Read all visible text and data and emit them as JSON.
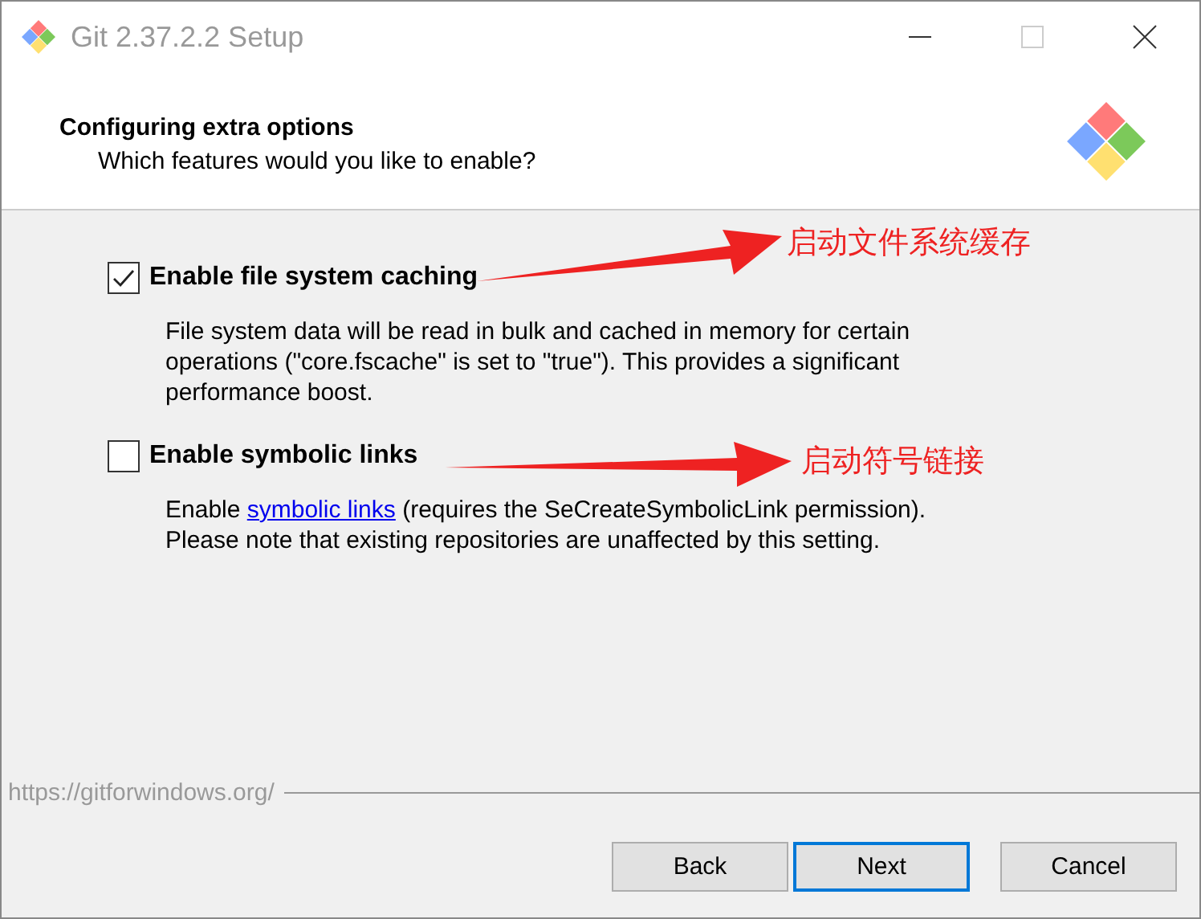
{
  "window": {
    "title": "Git 2.37.2.2 Setup"
  },
  "header": {
    "title": "Configuring extra options",
    "subtitle": "Which features would you like to enable?"
  },
  "options": [
    {
      "label": "Enable file system caching",
      "checked": true,
      "description_lines": [
        [
          {
            "kind": "text",
            "text": "File system data will be read in bulk and cached in memory for certain"
          }
        ],
        [
          {
            "kind": "text",
            "text": "operations (\"core.fscache\" is set to \"true\"). This provides a significant"
          }
        ],
        [
          {
            "kind": "text",
            "text": "performance boost."
          }
        ]
      ]
    },
    {
      "label": "Enable symbolic links",
      "checked": false,
      "description_lines": [
        [
          {
            "kind": "text",
            "text": "Enable "
          },
          {
            "kind": "link",
            "text": "symbolic links"
          },
          {
            "kind": "text",
            "text": " (requires the SeCreateSymbolicLink permission)."
          }
        ],
        [
          {
            "kind": "text",
            "text": "Please note that existing repositories are unaffected by this setting."
          }
        ]
      ]
    }
  ],
  "annotations": [
    "启动文件系统缓存",
    "启动符号链接"
  ],
  "footer": {
    "url": "https://gitforwindows.org/"
  },
  "buttons": [
    {
      "label": "Back",
      "selected": false
    },
    {
      "label": "Next",
      "selected": true
    },
    {
      "label": "Cancel",
      "selected": false
    }
  ]
}
